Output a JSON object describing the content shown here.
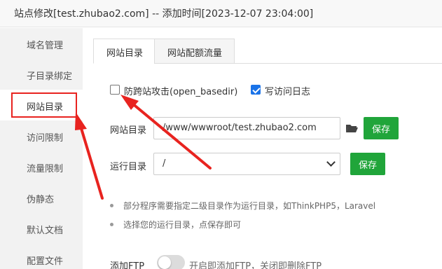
{
  "window": {
    "title": "站点修改[test.zhubao2.com] -- 添加时间[2023-12-07 23:04:00]"
  },
  "sidebar": {
    "items": [
      {
        "label": "域名管理"
      },
      {
        "label": "子目录绑定"
      },
      {
        "label": "网站目录",
        "active": true
      },
      {
        "label": "访问限制"
      },
      {
        "label": "流量限制"
      },
      {
        "label": "伪静态"
      },
      {
        "label": "默认文档"
      },
      {
        "label": "配置文件"
      }
    ]
  },
  "tabs": [
    {
      "label": "网站目录",
      "active": true
    },
    {
      "label": "网站配额流量",
      "active": false
    }
  ],
  "options": {
    "anti_cross_label": "防跨站攻击(open_basedir)",
    "anti_cross_checked": false,
    "write_log_label": "写访问日志",
    "write_log_checked": true
  },
  "site_dir": {
    "label": "网站目录",
    "value": "/www/wwwroot/test.zhubao2.com",
    "save_label": "保存"
  },
  "run_dir": {
    "label": "运行目录",
    "value": "/",
    "save_label": "保存"
  },
  "tips": [
    "部分程序需要指定二级目录作为运行目录，如ThinkPHP5，Laravel",
    "选择您的运行目录，点保存即可"
  ],
  "ftp": {
    "label": "添加FTP",
    "enabled": false,
    "description": "开启即添加FTP，关闭即删除FTP"
  },
  "colors": {
    "accent_green": "#20a53a",
    "checkbox_blue": "#1a73e8",
    "highlight_red": "#e8231f"
  }
}
